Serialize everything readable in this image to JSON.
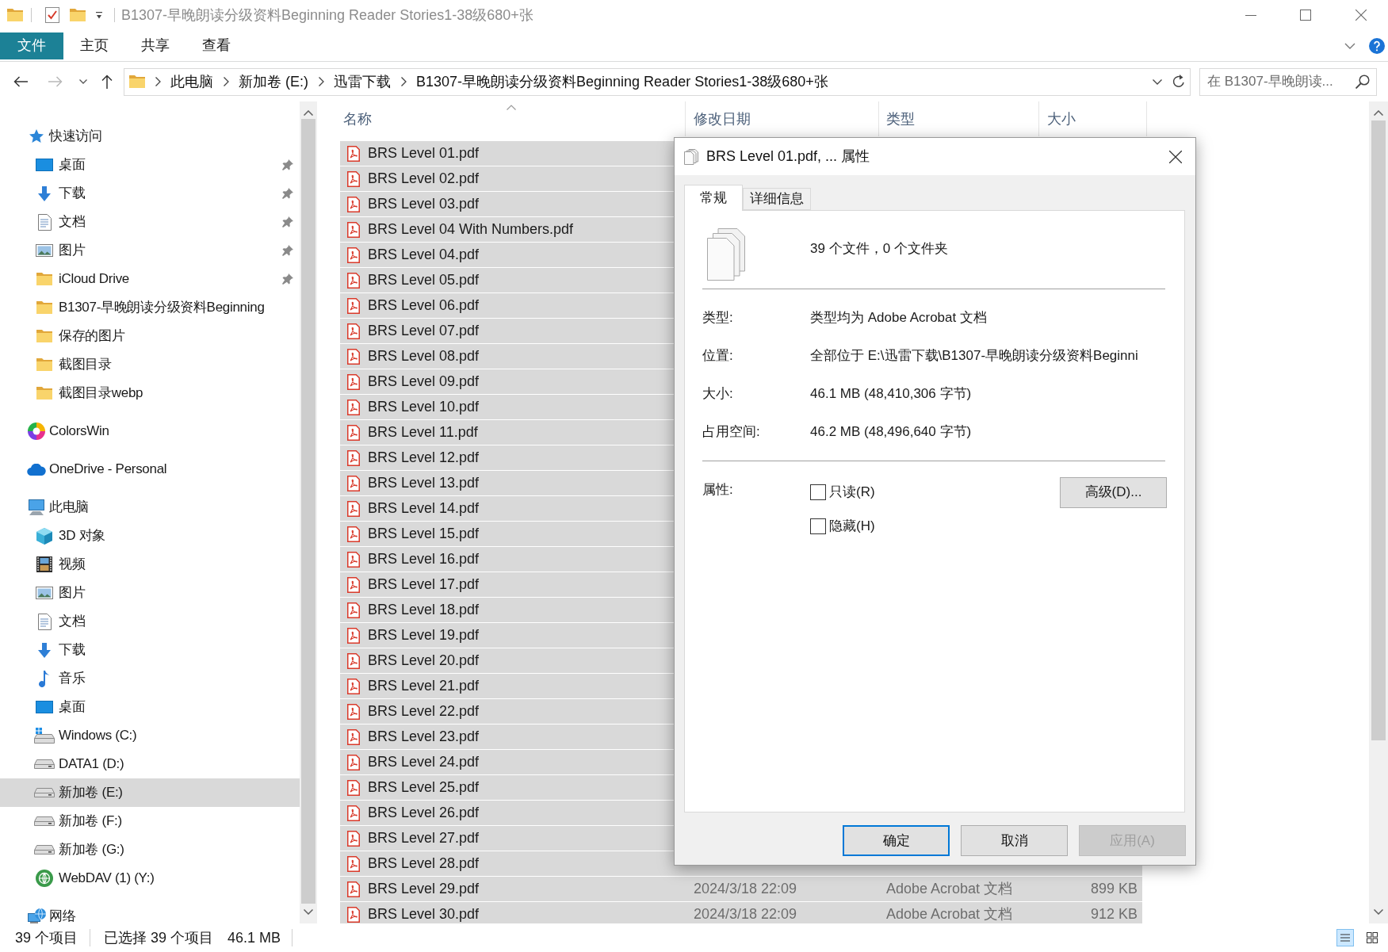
{
  "window": {
    "title": "B1307-早晚朗读分级资料Beginning Reader Stories1-38级680+张"
  },
  "ribbon": {
    "file_button": "文件",
    "tabs": [
      "主页",
      "共享",
      "查看"
    ]
  },
  "address_bar": {
    "path": [
      "此电脑",
      "新加卷 (E:)",
      "迅雷下载",
      "B1307-早晚朗读分级资料Beginning Reader Stories1-38级680+张"
    ]
  },
  "search": {
    "placeholder": "在 B1307-早晚朗读..."
  },
  "navigation": {
    "items": [
      {
        "label": "快速访问",
        "kind": "star",
        "selected": false,
        "children": [
          {
            "label": "桌面",
            "kind": "desktop",
            "pinned": true,
            "selected": false
          },
          {
            "label": "下载",
            "kind": "download",
            "pinned": true,
            "selected": false
          },
          {
            "label": "文档",
            "kind": "documents",
            "pinned": true,
            "selected": false
          },
          {
            "label": "图片",
            "kind": "pictures",
            "pinned": true,
            "selected": false
          },
          {
            "label": "iCloud Drive",
            "kind": "folder",
            "pinned": true,
            "selected": false
          },
          {
            "label": "B1307-早晚朗读分级资料Beginning",
            "kind": "folder",
            "pinned": false,
            "selected": false
          },
          {
            "label": "保存的图片",
            "kind": "folder",
            "pinned": false,
            "selected": false
          },
          {
            "label": "截图目录",
            "kind": "folder",
            "pinned": false,
            "selected": false
          },
          {
            "label": "截图目录webp",
            "kind": "folder",
            "pinned": false,
            "selected": false
          }
        ]
      },
      {
        "label": "ColorsWin",
        "kind": "colors",
        "selected": false
      },
      {
        "label": "OneDrive - Personal",
        "kind": "cloud",
        "selected": false
      },
      {
        "label": "此电脑",
        "kind": "pc",
        "selected": false,
        "children": [
          {
            "label": "3D 对象",
            "kind": "cube",
            "selected": false
          },
          {
            "label": "视频",
            "kind": "video",
            "selected": false
          },
          {
            "label": "图片",
            "kind": "pictures",
            "selected": false
          },
          {
            "label": "文档",
            "kind": "documents",
            "selected": false
          },
          {
            "label": "下载",
            "kind": "download",
            "selected": false
          },
          {
            "label": "音乐",
            "kind": "music",
            "selected": false
          },
          {
            "label": "桌面",
            "kind": "desktop",
            "selected": false
          },
          {
            "label": "Windows (C:)",
            "kind": "system_drive",
            "selected": false
          },
          {
            "label": "DATA1 (D:)",
            "kind": "drive",
            "selected": false
          },
          {
            "label": "新加卷 (E:)",
            "kind": "drive",
            "selected": true
          },
          {
            "label": "新加卷 (F:)",
            "kind": "drive",
            "selected": false
          },
          {
            "label": "新加卷 (G:)",
            "kind": "drive",
            "selected": false
          },
          {
            "label": "WebDAV (1) (Y:)",
            "kind": "webdav",
            "selected": false
          }
        ]
      },
      {
        "label": "网络",
        "kind": "network",
        "selected": false
      }
    ]
  },
  "file_list": {
    "columns": [
      {
        "label": "名称",
        "sorted": true
      },
      {
        "label": "修改日期",
        "sorted": false
      },
      {
        "label": "类型",
        "sorted": false
      },
      {
        "label": "大小",
        "sorted": false
      }
    ],
    "rows": [
      {
        "name": "BRS Level 01.pdf",
        "selected": true
      },
      {
        "name": "BRS Level 02.pdf",
        "selected": true
      },
      {
        "name": "BRS Level 03.pdf",
        "selected": true
      },
      {
        "name": "BRS Level 04 With Numbers.pdf",
        "selected": true
      },
      {
        "name": "BRS Level 04.pdf",
        "selected": true
      },
      {
        "name": "BRS Level 05.pdf",
        "selected": true
      },
      {
        "name": "BRS Level 06.pdf",
        "selected": true
      },
      {
        "name": "BRS Level 07.pdf",
        "selected": true
      },
      {
        "name": "BRS Level 08.pdf",
        "selected": true
      },
      {
        "name": "BRS Level 09.pdf",
        "selected": true
      },
      {
        "name": "BRS Level 10.pdf",
        "selected": true
      },
      {
        "name": "BRS Level 11.pdf",
        "selected": true
      },
      {
        "name": "BRS Level 12.pdf",
        "selected": true
      },
      {
        "name": "BRS Level 13.pdf",
        "selected": true
      },
      {
        "name": "BRS Level 14.pdf",
        "selected": true
      },
      {
        "name": "BRS Level 15.pdf",
        "selected": true
      },
      {
        "name": "BRS Level 16.pdf",
        "selected": true
      },
      {
        "name": "BRS Level 17.pdf",
        "selected": true
      },
      {
        "name": "BRS Level 18.pdf",
        "selected": true
      },
      {
        "name": "BRS Level 19.pdf",
        "selected": true
      },
      {
        "name": "BRS Level 20.pdf",
        "selected": true
      },
      {
        "name": "BRS Level 21.pdf",
        "selected": true
      },
      {
        "name": "BRS Level 22.pdf",
        "selected": true
      },
      {
        "name": "BRS Level 23.pdf",
        "selected": true
      },
      {
        "name": "BRS Level 24.pdf",
        "selected": true
      },
      {
        "name": "BRS Level 25.pdf",
        "selected": true
      },
      {
        "name": "BRS Level 26.pdf",
        "selected": true
      },
      {
        "name": "BRS Level 27.pdf",
        "selected": true
      },
      {
        "name": "BRS Level 28.pdf",
        "selected": true
      },
      {
        "name": "BRS Level 29.pdf",
        "modified": "2024/3/18 22:09",
        "type": "Adobe Acrobat 文档",
        "size": "899 KB",
        "selected": true
      },
      {
        "name": "BRS Level 30.pdf",
        "modified": "2024/3/18 22:09",
        "type": "Adobe Acrobat 文档",
        "size": "912 KB",
        "selected": true
      }
    ]
  },
  "status_bar": {
    "item_count": "39 个项目",
    "selection": "已选择 39 个项目",
    "selection_size": "46.1 MB",
    "view_buttons": [
      {
        "kind": "details",
        "selected": true
      },
      {
        "kind": "large_icons",
        "selected": false
      }
    ]
  },
  "dialog": {
    "title": "BRS Level 01.pdf, ... 属性",
    "tabs": [
      {
        "label": "常规",
        "selected": true
      },
      {
        "label": "详细信息",
        "selected": false
      }
    ],
    "summary": "39 个文件，0 个文件夹",
    "fields": [
      {
        "label": "类型:",
        "value": "类型均为 Adobe Acrobat 文档"
      },
      {
        "label": "位置:",
        "value": "全部位于 E:\\迅雷下载\\B1307-早晚朗读分级资料Beginni"
      },
      {
        "label": "大小:",
        "value": "46.1 MB (48,410,306 字节)"
      },
      {
        "label": "占用空间:",
        "value": "46.2 MB (48,496,640 字节)"
      }
    ],
    "attributes_label": "属性:",
    "checkboxes": [
      {
        "label": "只读(R)",
        "checked": false
      },
      {
        "label": "隐藏(H)",
        "checked": false
      }
    ],
    "advanced_button": "高级(D)...",
    "buttons": [
      {
        "label": "确定",
        "default": true,
        "disabled": false
      },
      {
        "label": "取消",
        "default": false,
        "disabled": false
      },
      {
        "label": "应用(A)",
        "default": false,
        "disabled": true
      }
    ]
  }
}
